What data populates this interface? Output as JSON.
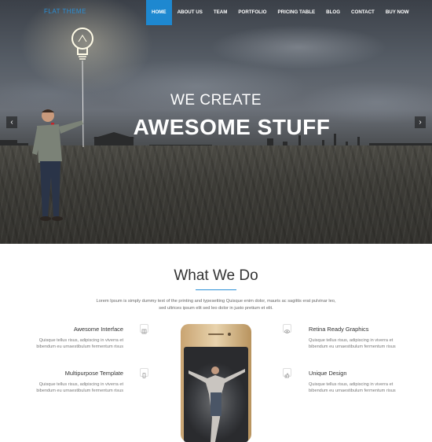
{
  "navbar": {
    "logo": "FLAT THEME",
    "menu": [
      {
        "label": "HOME",
        "active": true
      },
      {
        "label": "ABOUT US"
      },
      {
        "label": "TEAM"
      },
      {
        "label": "PORTFOLIO"
      },
      {
        "label": "PRICING TABLE"
      },
      {
        "label": "BLOG"
      },
      {
        "label": "CONTACT"
      },
      {
        "label": "BUY NOW"
      }
    ]
  },
  "hero": {
    "line1": "WE CREATE",
    "line2": "AWESOME STUFF",
    "prev_icon": "chevron-left-icon",
    "next_icon": "chevron-right-icon"
  },
  "section": {
    "title": "What We Do",
    "intro": "Lorem Ipsum is simply dummy text of the printing and typesetting Quisque enim dolor, mauris ac sagittis erat pulvinar leo, sed ultrices ipsum elit sed leo dolor in justo pretium et elit.",
    "features": [
      {
        "title": "Awesome Interface",
        "desc": "Quisque tellus risus, adipiscing in viverra et bibendum eu urnaestibulum fermentum risus",
        "icon": "layout-icon"
      },
      {
        "title": "Multipurpose Template",
        "desc": "Quisque tellus risus, adipiscing in viverra et bibendum eu urnaestibulum fermentum risus",
        "icon": "mobile-icon"
      },
      {
        "title": "Retina Ready Graphics",
        "desc": "Quisque tellus risus, adipiscing in viverra et bibendum eu urnaestibulum fermentum risus",
        "icon": "eye-icon"
      },
      {
        "title": "Unique Design",
        "desc": "Quisque tellus risus, adipiscing in viverra et bibendum eu urnaestibulum fermentum risus",
        "icon": "thumbs-up-icon"
      }
    ]
  },
  "colors": {
    "accent": "#1e88d0",
    "text": "#333333"
  }
}
